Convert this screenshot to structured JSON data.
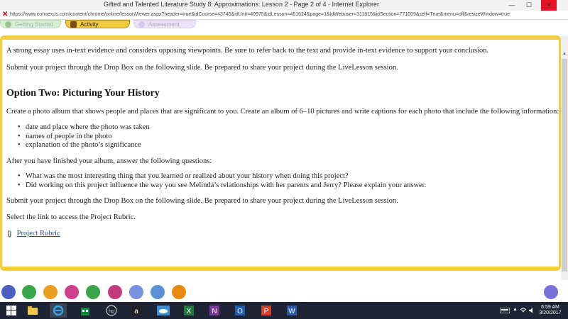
{
  "window": {
    "title": "Gifted and Talented Literature Study 8: Approximations: Lesson 2 - Page 2 of 4 - Internet Explorer",
    "minimize": "—",
    "maximize": "☐",
    "close": "✕"
  },
  "address": {
    "url": "https://www.connexus.com/content/chrome/online/lessonViewer.aspx?header=true&idCourse=43745&idUnit=40975&idLesson=451624&page=1&idWebuser=311815&idSection=771009&self=True&menu=off&resizeWindow=true"
  },
  "tabs": [
    {
      "label": "Getting Started"
    },
    {
      "label": "Activity"
    },
    {
      "label": "Assessment"
    }
  ],
  "content": {
    "intro1": "A strong essay uses in-text evidence and considers opposing viewpoints. Be sure to refer back to the text and provide in-text evidence to support your conclusion.",
    "intro2": "Submit your project through the Drop Box on the following slide. Be prepared to share your project during the LiveLesson session.",
    "heading": "Option Two: Picturing Your History",
    "para1": "Create a photo album that shows people and places that are significant to you. Create an album of 6–10 pictures and write captions for each photo that include the following information:",
    "list1": [
      "date and place where the photo was taken",
      "names of people in the photo",
      "explanation of the photo’s significance"
    ],
    "para2": "After you have finished your album, answer the following questions:",
    "list2": [
      "What was the most interesting thing that you learned or realized about your history when doing this project?",
      "Did working on this project influence the way you see Melinda’s relationships with her parents and Jerry? Please explain your answer."
    ],
    "para3": "Submit your project through the Drop Box on the following slide. Be prepared to share your project during the LiveLesson session.",
    "para4": "Select the link to access the Project Rubric.",
    "rubric_link": "Project Rubric"
  },
  "bottom_tools": [
    {
      "icon": "checkmark-icon",
      "color": "#4a5fc1"
    },
    {
      "icon": "globe-icon",
      "color": "#3aa54a"
    },
    {
      "icon": "puzzle-icon",
      "color": "#e8a020"
    },
    {
      "icon": "chat-icon",
      "color": "#d0408a"
    },
    {
      "icon": "calculator-icon",
      "color": "#3aa54a"
    },
    {
      "icon": "target-icon",
      "color": "#c23b7a"
    },
    {
      "icon": "notes-icon",
      "color": "#7a8fe0"
    },
    {
      "icon": "printer-icon",
      "color": "#5b8fd6"
    },
    {
      "icon": "help-icon",
      "color": "#e88a10"
    }
  ],
  "taskbar": {
    "apps": [
      {
        "icon": "windows-start-icon"
      },
      {
        "icon": "file-explorer-icon"
      },
      {
        "icon": "internet-explorer-icon"
      },
      {
        "icon": "store-icon"
      },
      {
        "icon": "hp-icon"
      },
      {
        "icon": "amazon-icon"
      },
      {
        "icon": "onedrive-icon"
      },
      {
        "icon": "excel-icon"
      },
      {
        "icon": "onenote-icon"
      },
      {
        "icon": "outlook-icon"
      },
      {
        "icon": "powerpoint-icon"
      },
      {
        "icon": "word-icon"
      }
    ],
    "time": "6:59 AM",
    "date": "3/20/2017"
  }
}
